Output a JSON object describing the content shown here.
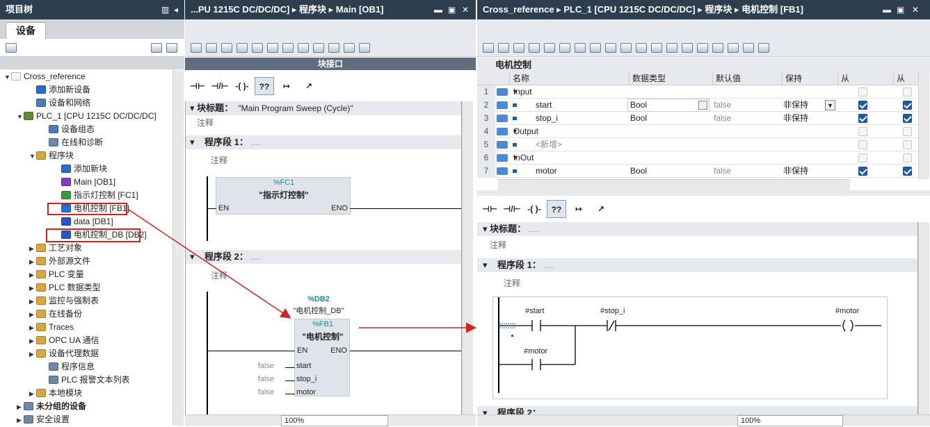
{
  "left": {
    "title": "项目树",
    "tab": "设备",
    "tree": [
      {
        "label": "Cross_reference",
        "indent": 0,
        "arrow": "▼",
        "color": "#f4f4f4"
      },
      {
        "label": "添加新设备",
        "indent": 2,
        "arrow": "",
        "color": "#2a6bd1"
      },
      {
        "label": "设备和网络",
        "indent": 2,
        "arrow": "",
        "color": "#4a7db8"
      },
      {
        "label": "PLC_1 [CPU 1215C DC/DC/DC]",
        "indent": 1,
        "arrow": "▼",
        "color": "#5b8c3a"
      },
      {
        "label": "设备组态",
        "indent": 3,
        "arrow": "",
        "color": "#4a7db8"
      },
      {
        "label": "在线和诊断",
        "indent": 3,
        "arrow": "",
        "color": "#6c8aa8"
      },
      {
        "label": "程序块",
        "indent": 2,
        "arrow": "▼",
        "color": "#d9a640"
      },
      {
        "label": "添加新块",
        "indent": 4,
        "arrow": "",
        "color": "#2a6bd1"
      },
      {
        "label": "Main [OB1]",
        "indent": 4,
        "arrow": "",
        "color": "#8a37c2"
      },
      {
        "label": "指示灯控制 [FC1]",
        "indent": 4,
        "arrow": "",
        "color": "#3a9a3a"
      },
      {
        "label": "电机控制 [FB1]",
        "indent": 4,
        "arrow": "",
        "color": "#1e73d8"
      },
      {
        "label": "data [DB1]",
        "indent": 4,
        "arrow": "",
        "color": "#2a55c8"
      },
      {
        "label": "电机控制_DB [DB2]",
        "indent": 4,
        "arrow": "",
        "color": "#2a55c8"
      },
      {
        "label": "工艺对象",
        "indent": 2,
        "arrow": "▶",
        "color": "#d9a640"
      },
      {
        "label": "外部源文件",
        "indent": 2,
        "arrow": "▶",
        "color": "#d9a640"
      },
      {
        "label": "PLC 变量",
        "indent": 2,
        "arrow": "▶",
        "color": "#d9a640"
      },
      {
        "label": "PLC 数据类型",
        "indent": 2,
        "arrow": "▶",
        "color": "#d9a640"
      },
      {
        "label": "监控与强制表",
        "indent": 2,
        "arrow": "▶",
        "color": "#d9a640"
      },
      {
        "label": "在线备份",
        "indent": 2,
        "arrow": "▶",
        "color": "#d9a640"
      },
      {
        "label": "Traces",
        "indent": 2,
        "arrow": "▶",
        "color": "#d9a640"
      },
      {
        "label": "OPC UA 通信",
        "indent": 2,
        "arrow": "▶",
        "color": "#d9a640"
      },
      {
        "label": "设备代理数据",
        "indent": 2,
        "arrow": "▶",
        "color": "#d9a640"
      },
      {
        "label": "程序信息",
        "indent": 3,
        "arrow": "",
        "color": "#6c8aa8"
      },
      {
        "label": "PLC 报警文本列表",
        "indent": 3,
        "arrow": "",
        "color": "#6c8aa8"
      },
      {
        "label": "本地模块",
        "indent": 2,
        "arrow": "▶",
        "color": "#d9a640"
      },
      {
        "label": "未分组的设备",
        "indent": 1,
        "arrow": "▶",
        "color": "#6c8aa8"
      },
      {
        "label": "安全设置",
        "indent": 1,
        "arrow": "▶",
        "color": "#6c8aa8"
      }
    ]
  },
  "mid": {
    "title": "...PU 1215C DC/DC/DC] ▸ 程序块 ▸ Main [OB1]",
    "interface_label": "块接口",
    "ladder_buttons": [
      "⊣⊢",
      "⊣/⊢",
      "-( )-",
      "??",
      "↦",
      "↗"
    ],
    "block_title_label": "块标题：",
    "block_title_value": "\"Main Program Sweep (Cycle)\"",
    "comment": "注释",
    "seg1": {
      "label": "程序段 1：",
      "dots": ".....",
      "comment": "注释",
      "fc_addr": "%FC1",
      "fc_name": "\"指示灯控制\"",
      "en": "EN",
      "eno": "ENO"
    },
    "seg2": {
      "label": "程序段 2：",
      "dots": ".....",
      "comment": "注释",
      "db_addr": "%DB2",
      "db_name": "\"电机控制_DB\"",
      "fb_addr": "%FB1",
      "fb_name": "\"电机控制\"",
      "en": "EN",
      "eno": "ENO",
      "pins": [
        {
          "val": "false",
          "name": "start"
        },
        {
          "val": "false",
          "name": "stop_i"
        },
        {
          "val": "false",
          "name": "motor"
        }
      ]
    },
    "zoom": "100%"
  },
  "right": {
    "title": "Cross_reference ▸ PLC_1 [CPU 1215C DC/DC/DC] ▸ 程序块 ▸ 电机控制 [FB1]",
    "block_name": "电机控制",
    "headers": [
      "名称",
      "数据类型",
      "默认值",
      "保持",
      "从 HMI/OPC...",
      "从"
    ],
    "rows": [
      {
        "n": "1",
        "name": "Input",
        "type": "",
        "def": "",
        "keep": "",
        "h1": "off",
        "h2": "off",
        "section": true
      },
      {
        "n": "2",
        "name": "start",
        "type": "Bool",
        "def": "false",
        "keep": "非保持",
        "h1": "on",
        "h2": "on",
        "section": false
      },
      {
        "n": "3",
        "name": "stop_i",
        "type": "Bool",
        "def": "false",
        "keep": "非保持",
        "h1": "on",
        "h2": "on",
        "section": false
      },
      {
        "n": "4",
        "name": "Output",
        "type": "",
        "def": "",
        "keep": "",
        "h1": "off",
        "h2": "off",
        "section": true
      },
      {
        "n": "5",
        "name": "<新增>",
        "type": "",
        "def": "",
        "keep": "",
        "h1": "off",
        "h2": "off",
        "section": false
      },
      {
        "n": "6",
        "name": "InOut",
        "type": "",
        "def": "",
        "keep": "",
        "h1": "off",
        "h2": "off",
        "section": true
      },
      {
        "n": "7",
        "name": "motor",
        "type": "Bool",
        "def": "false",
        "keep": "非保持",
        "h1": "on",
        "h2": "on",
        "section": false
      }
    ],
    "block_title_label": "块标题：",
    "block_title_dots": ".....",
    "comment": "注释",
    "seg1": {
      "label": "程序段 1：",
      "dots": ".....",
      "comment": "注释",
      "c1": "#start",
      "c2": "#stop_i",
      "coil": "#motor",
      "c3": "#motor"
    },
    "seg2_label": "程序段 2：",
    "zoom": "100%"
  }
}
